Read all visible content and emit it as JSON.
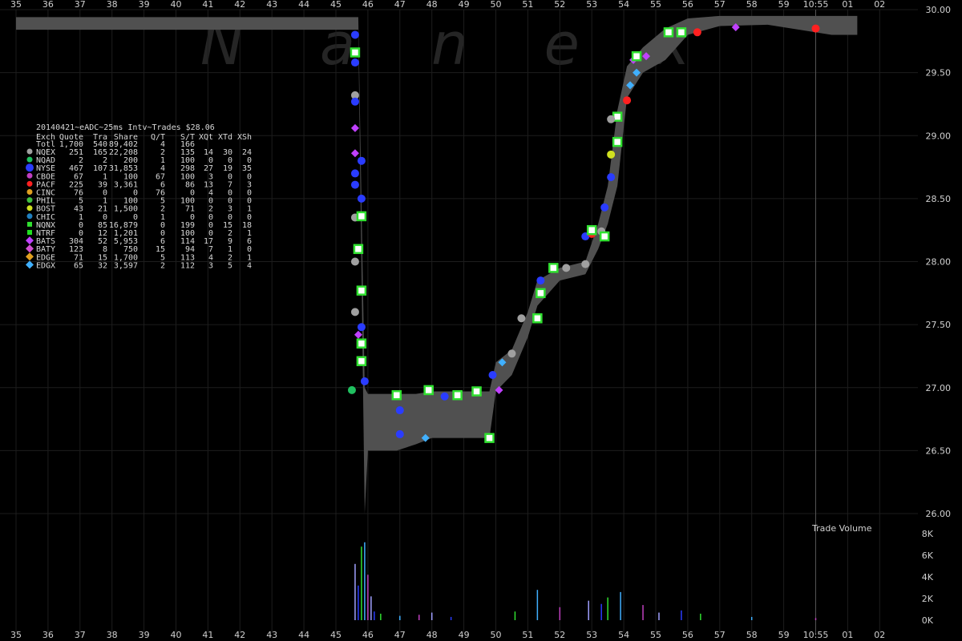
{
  "chart_data": {
    "type": "scatter",
    "watermark": "Nanex",
    "x_ticks_top": [
      "35",
      "36",
      "37",
      "38",
      "39",
      "40",
      "41",
      "42",
      "43",
      "44",
      "45",
      "46",
      "47",
      "48",
      "49",
      "50",
      "51",
      "52",
      "53",
      "54",
      "55",
      "56",
      "57",
      "58",
      "59",
      "10:55",
      "01",
      "02"
    ],
    "x_ticks_bottom": [
      "35",
      "36",
      "37",
      "38",
      "39",
      "40",
      "41",
      "42",
      "43",
      "44",
      "45",
      "46",
      "47",
      "48",
      "49",
      "50",
      "51",
      "52",
      "53",
      "54",
      "55",
      "56",
      "57",
      "58",
      "59",
      "10:55",
      "01",
      "02"
    ],
    "y_ticks": [
      "30.00",
      "29.50",
      "29.00",
      "28.50",
      "28.00",
      "27.50",
      "27.00",
      "26.50",
      "26.00"
    ],
    "ylim": [
      26.0,
      30.0
    ],
    "volume_label": "Trade Volume",
    "volume_ticks": [
      "8K",
      "6K",
      "4K",
      "2K",
      "0K"
    ],
    "volume_lim": [
      0,
      8000
    ],
    "legend": {
      "title": "20140421~eADC~25ms Intv~Trades $28.06",
      "columns": [
        "Exch",
        "Quote",
        "Tra",
        "Share",
        "Q/T",
        "S/T",
        "XQt",
        "XTd",
        "XSh"
      ],
      "total": [
        "Totl",
        "1,700",
        "540",
        "89,402",
        "4",
        "166",
        "",
        "",
        ""
      ],
      "rows": [
        {
          "exch": "NQEX",
          "cells": [
            "251",
            "165",
            "22,208",
            "2",
            "135",
            "14",
            "30",
            "24"
          ],
          "color": "#a0a0a0",
          "marker": "circle"
        },
        {
          "exch": "NQAD",
          "cells": [
            "2",
            "2",
            "200",
            "1",
            "100",
            "0",
            "0",
            "0"
          ],
          "color": "#20c060",
          "marker": "circle"
        },
        {
          "exch": "NYSE",
          "cells": [
            "467",
            "107",
            "31,853",
            "4",
            "298",
            "27",
            "19",
            "35"
          ],
          "color": "#2a3cff",
          "marker": "circle"
        },
        {
          "exch": "CBOE",
          "cells": [
            "67",
            "1",
            "100",
            "67",
            "100",
            "3",
            "0",
            "0"
          ],
          "color": "#c040c0",
          "marker": "circle"
        },
        {
          "exch": "PACF",
          "cells": [
            "225",
            "39",
            "3,361",
            "6",
            "86",
            "13",
            "7",
            "3"
          ],
          "color": "#ff2020",
          "marker": "circle"
        },
        {
          "exch": "CINC",
          "cells": [
            "76",
            "0",
            "0",
            "76",
            "0",
            "4",
            "0",
            "0"
          ],
          "color": "#e0a020",
          "marker": "circle"
        },
        {
          "exch": "PHIL",
          "cells": [
            "5",
            "1",
            "100",
            "5",
            "100",
            "0",
            "0",
            "0"
          ],
          "color": "#40c040",
          "marker": "circle"
        },
        {
          "exch": "BOST",
          "cells": [
            "43",
            "21",
            "1,500",
            "2",
            "71",
            "2",
            "3",
            "1"
          ],
          "color": "#d0e020",
          "marker": "circle"
        },
        {
          "exch": "CHIC",
          "cells": [
            "1",
            "0",
            "0",
            "1",
            "0",
            "0",
            "0",
            "0"
          ],
          "color": "#2080c0",
          "marker": "circle"
        },
        {
          "exch": "NQNX",
          "cells": [
            "0",
            "85",
            "16,879",
            "0",
            "199",
            "0",
            "15",
            "18"
          ],
          "color": "#30e030",
          "marker": "square"
        },
        {
          "exch": "NTRF",
          "cells": [
            "0",
            "12",
            "1,201",
            "0",
            "100",
            "0",
            "2",
            "1"
          ],
          "color": "#20e020",
          "marker": "square"
        },
        {
          "exch": "BATS",
          "cells": [
            "304",
            "52",
            "5,953",
            "6",
            "114",
            "17",
            "9",
            "6"
          ],
          "color": "#c040ff",
          "marker": "diamond"
        },
        {
          "exch": "BATY",
          "cells": [
            "123",
            "8",
            "750",
            "15",
            "94",
            "7",
            "1",
            "0"
          ],
          "color": "#d050d0",
          "marker": "diamond"
        },
        {
          "exch": "EDGE",
          "cells": [
            "71",
            "15",
            "1,700",
            "5",
            "113",
            "4",
            "2",
            "1"
          ],
          "color": "#e0a020",
          "marker": "diamond"
        },
        {
          "exch": "EDGX",
          "cells": [
            "65",
            "32",
            "3,597",
            "2",
            "112",
            "3",
            "5",
            "4"
          ],
          "color": "#40b0ff",
          "marker": "diamond"
        }
      ]
    },
    "nbbo_band": [
      {
        "x": 35.0,
        "lo": 29.94,
        "hi": 29.84
      },
      {
        "x": 45.7,
        "lo": 29.94,
        "hi": 29.84
      },
      {
        "x": 45.9,
        "lo": 27.0,
        "hi": 26.0
      },
      {
        "x": 46.0,
        "lo": 26.95,
        "hi": 26.5
      },
      {
        "x": 46.9,
        "lo": 26.95,
        "hi": 26.5
      },
      {
        "x": 47.5,
        "lo": 26.95,
        "hi": 26.55
      },
      {
        "x": 48.0,
        "lo": 26.97,
        "hi": 26.6
      },
      {
        "x": 49.0,
        "lo": 26.97,
        "hi": 26.6
      },
      {
        "x": 49.8,
        "lo": 26.97,
        "hi": 26.6
      },
      {
        "x": 50.0,
        "lo": 27.2,
        "hi": 26.97
      },
      {
        "x": 50.5,
        "lo": 27.3,
        "hi": 27.1
      },
      {
        "x": 51.0,
        "lo": 27.6,
        "hi": 27.4
      },
      {
        "x": 51.3,
        "lo": 27.85,
        "hi": 27.65
      },
      {
        "x": 52.0,
        "lo": 27.95,
        "hi": 27.85
      },
      {
        "x": 52.8,
        "lo": 28.0,
        "hi": 27.9
      },
      {
        "x": 53.2,
        "lo": 28.3,
        "hi": 28.1
      },
      {
        "x": 53.5,
        "lo": 28.6,
        "hi": 28.3
      },
      {
        "x": 53.8,
        "lo": 29.2,
        "hi": 28.6
      },
      {
        "x": 54.1,
        "lo": 29.55,
        "hi": 29.3
      },
      {
        "x": 54.6,
        "lo": 29.7,
        "hi": 29.5
      },
      {
        "x": 55.3,
        "lo": 29.85,
        "hi": 29.6
      },
      {
        "x": 56.0,
        "lo": 29.93,
        "hi": 29.8
      },
      {
        "x": 57.0,
        "lo": 29.95,
        "hi": 29.87
      },
      {
        "x": 58.5,
        "lo": 29.95,
        "hi": 29.88
      },
      {
        "x": 60.5,
        "lo": 29.95,
        "hi": 29.8
      },
      {
        "x": 61.3,
        "lo": 29.95,
        "hi": 29.8
      }
    ],
    "trades": [
      {
        "x": 45.6,
        "y": 29.8,
        "ex": "NYSE"
      },
      {
        "x": 45.6,
        "y": 29.66,
        "ex": "NQNX"
      },
      {
        "x": 45.6,
        "y": 29.58,
        "ex": "NYSE"
      },
      {
        "x": 45.6,
        "y": 29.32,
        "ex": "NQEX"
      },
      {
        "x": 45.6,
        "y": 29.27,
        "ex": "NYSE"
      },
      {
        "x": 45.6,
        "y": 29.06,
        "ex": "BATS"
      },
      {
        "x": 45.6,
        "y": 28.86,
        "ex": "BATS"
      },
      {
        "x": 45.6,
        "y": 28.7,
        "ex": "NYSE"
      },
      {
        "x": 45.6,
        "y": 28.61,
        "ex": "NYSE"
      },
      {
        "x": 45.6,
        "y": 28.35,
        "ex": "NQEX"
      },
      {
        "x": 45.6,
        "y": 28.0,
        "ex": "NQEX"
      },
      {
        "x": 45.6,
        "y": 27.6,
        "ex": "NQEX"
      },
      {
        "x": 45.7,
        "y": 27.42,
        "ex": "BATS"
      },
      {
        "x": 45.8,
        "y": 27.21,
        "ex": "NQNX"
      },
      {
        "x": 45.9,
        "y": 27.05,
        "ex": "NYSE"
      },
      {
        "x": 45.8,
        "y": 28.8,
        "ex": "NYSE"
      },
      {
        "x": 45.8,
        "y": 28.5,
        "ex": "NYSE"
      },
      {
        "x": 45.8,
        "y": 28.36,
        "ex": "NQNX"
      },
      {
        "x": 45.8,
        "y": 27.77,
        "ex": "NQNX"
      },
      {
        "x": 45.8,
        "y": 27.48,
        "ex": "NYSE"
      },
      {
        "x": 45.8,
        "y": 27.35,
        "ex": "NQNX"
      },
      {
        "x": 45.7,
        "y": 28.1,
        "ex": "NQNX"
      },
      {
        "x": 45.5,
        "y": 26.98,
        "ex": "NQAD"
      },
      {
        "x": 46.9,
        "y": 26.94,
        "ex": "NQNX"
      },
      {
        "x": 47.9,
        "y": 26.98,
        "ex": "NQNX"
      },
      {
        "x": 48.8,
        "y": 26.94,
        "ex": "NQNX"
      },
      {
        "x": 47.8,
        "y": 26.6,
        "ex": "EDGX"
      },
      {
        "x": 49.4,
        "y": 26.97,
        "ex": "NQNX"
      },
      {
        "x": 49.8,
        "y": 26.6,
        "ex": "NQNX"
      },
      {
        "x": 49.9,
        "y": 27.1,
        "ex": "NYSE"
      },
      {
        "x": 50.2,
        "y": 27.2,
        "ex": "EDGX"
      },
      {
        "x": 50.5,
        "y": 27.27,
        "ex": "NQEX"
      },
      {
        "x": 50.8,
        "y": 27.55,
        "ex": "NQEX"
      },
      {
        "x": 51.3,
        "y": 27.55,
        "ex": "NQNX"
      },
      {
        "x": 51.4,
        "y": 27.75,
        "ex": "NQNX"
      },
      {
        "x": 51.4,
        "y": 27.85,
        "ex": "NYSE"
      },
      {
        "x": 51.8,
        "y": 27.95,
        "ex": "NQNX"
      },
      {
        "x": 52.2,
        "y": 27.95,
        "ex": "NQEX"
      },
      {
        "x": 52.8,
        "y": 27.98,
        "ex": "NQEX"
      },
      {
        "x": 52.8,
        "y": 28.2,
        "ex": "NYSE"
      },
      {
        "x": 53.0,
        "y": 28.22,
        "ex": "PACF"
      },
      {
        "x": 53.0,
        "y": 28.25,
        "ex": "NQNX"
      },
      {
        "x": 53.3,
        "y": 28.24,
        "ex": "NQEX"
      },
      {
        "x": 53.4,
        "y": 28.2,
        "ex": "NQNX"
      },
      {
        "x": 53.4,
        "y": 28.43,
        "ex": "NYSE"
      },
      {
        "x": 53.6,
        "y": 28.67,
        "ex": "NYSE"
      },
      {
        "x": 53.6,
        "y": 28.85,
        "ex": "BOST"
      },
      {
        "x": 53.8,
        "y": 28.95,
        "ex": "NQNX"
      },
      {
        "x": 53.8,
        "y": 29.15,
        "ex": "NQNX"
      },
      {
        "x": 53.6,
        "y": 29.13,
        "ex": "NQEX"
      },
      {
        "x": 54.1,
        "y": 29.28,
        "ex": "PACF"
      },
      {
        "x": 54.2,
        "y": 29.4,
        "ex": "EDGX"
      },
      {
        "x": 54.4,
        "y": 29.5,
        "ex": "EDGX"
      },
      {
        "x": 54.3,
        "y": 29.6,
        "ex": "BATS"
      },
      {
        "x": 54.4,
        "y": 29.63,
        "ex": "NQNX"
      },
      {
        "x": 54.7,
        "y": 29.63,
        "ex": "BATS"
      },
      {
        "x": 55.4,
        "y": 29.82,
        "ex": "NQNX"
      },
      {
        "x": 55.8,
        "y": 29.82,
        "ex": "NQNX"
      },
      {
        "x": 56.3,
        "y": 29.82,
        "ex": "PACF"
      },
      {
        "x": 57.5,
        "y": 29.86,
        "ex": "BATS"
      },
      {
        "x": 60.0,
        "y": 29.85,
        "ex": "PACF"
      },
      {
        "x": 50.1,
        "y": 26.98,
        "ex": "BATS"
      },
      {
        "x": 48.4,
        "y": 26.93,
        "ex": "NYSE"
      },
      {
        "x": 47.0,
        "y": 26.82,
        "ex": "NYSE"
      },
      {
        "x": 47.0,
        "y": 26.63,
        "ex": "NYSE"
      }
    ],
    "volume_bars": [
      {
        "x": 45.6,
        "v": 5200
      },
      {
        "x": 45.7,
        "v": 3200
      },
      {
        "x": 45.8,
        "v": 6800
      },
      {
        "x": 45.9,
        "v": 7200
      },
      {
        "x": 46.0,
        "v": 4200
      },
      {
        "x": 46.1,
        "v": 2200
      },
      {
        "x": 46.2,
        "v": 800
      },
      {
        "x": 46.4,
        "v": 600
      },
      {
        "x": 47.0,
        "v": 400
      },
      {
        "x": 47.6,
        "v": 500
      },
      {
        "x": 48.0,
        "v": 700
      },
      {
        "x": 48.6,
        "v": 300
      },
      {
        "x": 50.6,
        "v": 800
      },
      {
        "x": 51.3,
        "v": 2800
      },
      {
        "x": 52.0,
        "v": 1200
      },
      {
        "x": 52.9,
        "v": 1800
      },
      {
        "x": 53.3,
        "v": 1500
      },
      {
        "x": 53.5,
        "v": 2100
      },
      {
        "x": 53.9,
        "v": 2600
      },
      {
        "x": 54.6,
        "v": 1400
      },
      {
        "x": 55.1,
        "v": 700
      },
      {
        "x": 55.8,
        "v": 900
      },
      {
        "x": 56.4,
        "v": 600
      },
      {
        "x": 58.0,
        "v": 300
      },
      {
        "x": 60.0,
        "v": 200
      }
    ],
    "vertical_marker_x": 60.0,
    "grid": true,
    "legend_placement": "top-left"
  }
}
